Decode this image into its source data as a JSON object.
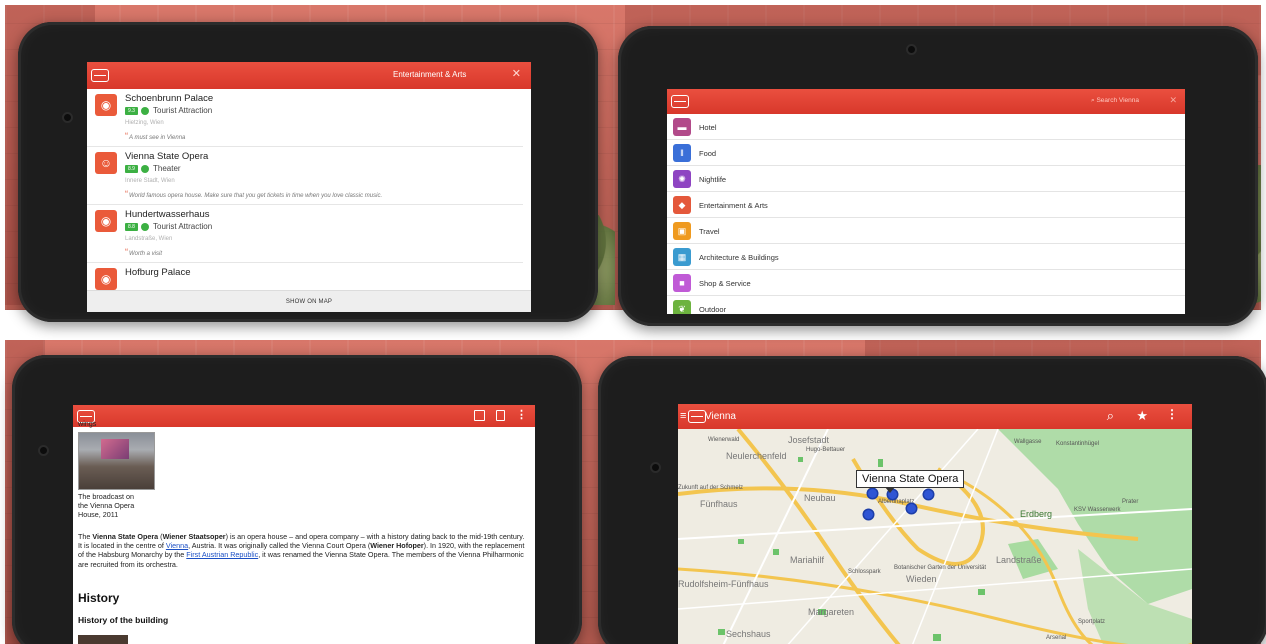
{
  "list_screen": {
    "title": "Entertainment & Arts",
    "close_icon": "close-icon",
    "items": [
      {
        "name": "Schoenbrunn Palace",
        "rating": "9.3",
        "category": "Tourist Attraction",
        "location": "Hietzing, Wien",
        "quote": "A must see in Vienna",
        "icon": "eye-icon"
      },
      {
        "name": "Vienna State Opera",
        "rating": "8.9",
        "category": "Theater",
        "location": "Innere Stadt, Wien",
        "quote": "World famous opera house. Make sure that you get tickets in time when you love classic music.",
        "icon": "theater-masks-icon"
      },
      {
        "name": "Hundertwasserhaus",
        "rating": "8.8",
        "category": "Tourist Attraction",
        "location": "Landstraße, Wien",
        "quote": "Worth a visit",
        "icon": "eye-icon"
      },
      {
        "name": "Hofburg Palace",
        "rating": "",
        "category": "",
        "location": "",
        "quote": "",
        "icon": "eye-icon"
      }
    ],
    "show_on_map": "SHOW ON MAP"
  },
  "category_screen": {
    "search_placeholder": "Search Vienna",
    "categories": [
      {
        "label": "Hotel",
        "icon": "bed-icon",
        "color": "#b24a8a"
      },
      {
        "label": "Food",
        "icon": "utensils-icon",
        "color": "#3a6fd8"
      },
      {
        "label": "Nightlife",
        "icon": "nightlife-icon",
        "color": "#8e44c2"
      },
      {
        "label": "Entertainment & Arts",
        "icon": "ticket-icon",
        "color": "#e4583b"
      },
      {
        "label": "Travel",
        "icon": "suitcase-icon",
        "color": "#ef9a1f"
      },
      {
        "label": "Architecture & Buildings",
        "icon": "building-icon",
        "color": "#3a9bd0"
      },
      {
        "label": "Shop & Service",
        "icon": "shopping-bag-icon",
        "color": "#c05ad6"
      },
      {
        "label": "Outdoor",
        "icon": "leaf-icon",
        "color": "#6db33f"
      }
    ]
  },
  "article_screen": {
    "top_fragment": "wings",
    "caption": [
      "The broadcast on",
      "the Vienna Opera",
      "House, 2011"
    ],
    "para": {
      "p1": "The ",
      "b1": "Vienna State Opera",
      "p2": " (",
      "b2": "Wiener Staatsoper",
      "p3": ") is an opera house – and opera company – with a history dating back to the mid-19th century. It is located in the centre of ",
      "link1": "Vienna",
      "p4": ", Austria. It was originally called the Vienna Court Opera (",
      "b3": "Wiener Hofoper",
      "p5": "). In 1920, with the replacement of the Habsburg Monarchy by the ",
      "link2": "First Austrian Republic",
      "p6": ", it was renamed the Vienna State Opera. The members of the Vienna Philharmonic are recruited from its orchestra."
    },
    "heading": "History",
    "subheading": "History of the building"
  },
  "map_screen": {
    "title": "Vienna",
    "popup": "Vienna State Opera",
    "labels": {
      "josefstadt": "Josefstadt",
      "neulerchenfeld": "Neulerchenfeld",
      "hugo": "Hugo-Bettauer",
      "neubau": "Neubau",
      "funfhaus": "Fünfhaus",
      "mariahilf": "Mariahilf",
      "rudolfsheim": "Rudolfsheim-Fünfhaus",
      "margareten": "Margareten",
      "sechshaus": "Sechshaus",
      "wieden": "Wieden",
      "landstrasse": "Landstraße",
      "erdberg": "Erdberg",
      "wienerwald": "Wienerwald",
      "prater": "Prater",
      "wasserwerk": "KSV Wasserwerk",
      "schlossgarten": "Schlosspark",
      "botanischer": "Botanischer Garten der Universität",
      "konstantin": "Konstantinhügel",
      "wallgasse": "Wallgasse",
      "zukunft": "Zukunft auf der Schmelz",
      "sportplatz": "Sportplatz",
      "albert": "Albertinaplatz",
      "arsenal": "Arsenal"
    }
  }
}
